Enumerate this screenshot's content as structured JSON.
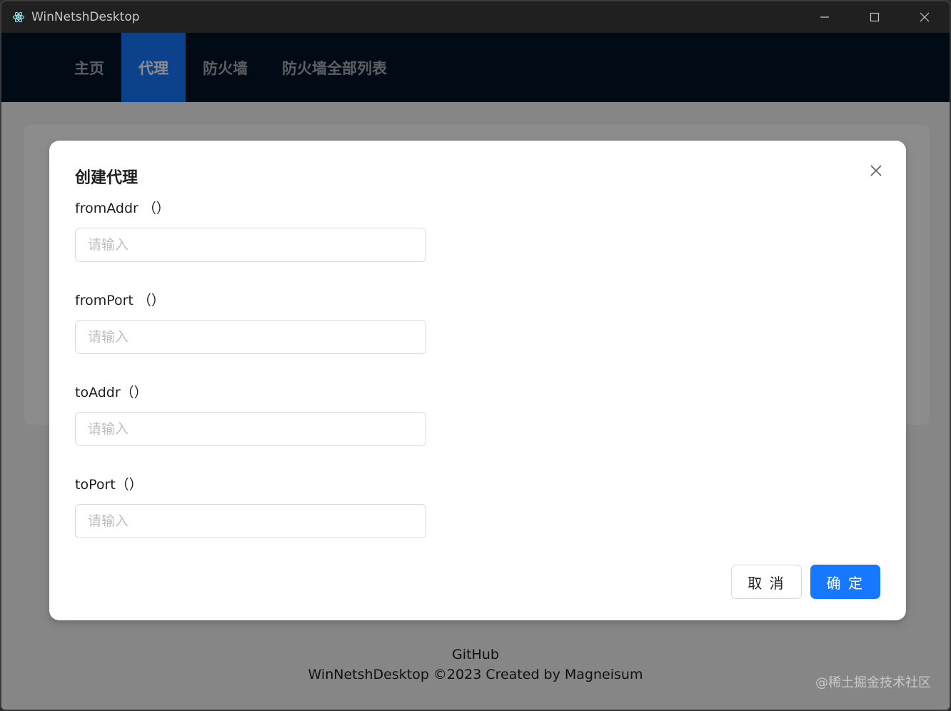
{
  "window": {
    "title": "WinNetshDesktop",
    "app_icon": "electron-icon",
    "controls": [
      "minimize-icon",
      "maximize-icon",
      "close-icon"
    ]
  },
  "nav": {
    "items": [
      {
        "label": "主页",
        "active": false
      },
      {
        "label": "代理",
        "active": true
      },
      {
        "label": "防火墙",
        "active": false
      },
      {
        "label": "防火墙全部列表",
        "active": false
      }
    ]
  },
  "modal": {
    "title": "创建代理",
    "close_icon": "close-icon",
    "fields": [
      {
        "label": "fromAddr （）",
        "placeholder": "请输入",
        "value": ""
      },
      {
        "label": "fromPort （）",
        "placeholder": "请输入",
        "value": ""
      },
      {
        "label": "toAddr（）",
        "placeholder": "请输入",
        "value": ""
      },
      {
        "label": "toPort（）",
        "placeholder": "请输入",
        "value": ""
      }
    ],
    "cancel_label": "取 消",
    "ok_label": "确 定"
  },
  "footer": {
    "github": "GitHub",
    "copyright": "WinNetshDesktop ©2023 Created by Magneisum"
  },
  "watermark": "@稀土掘金技术社区",
  "colors": {
    "primary": "#1677ff",
    "nav_bg": "#001529",
    "titlebar_bg": "#202020"
  }
}
